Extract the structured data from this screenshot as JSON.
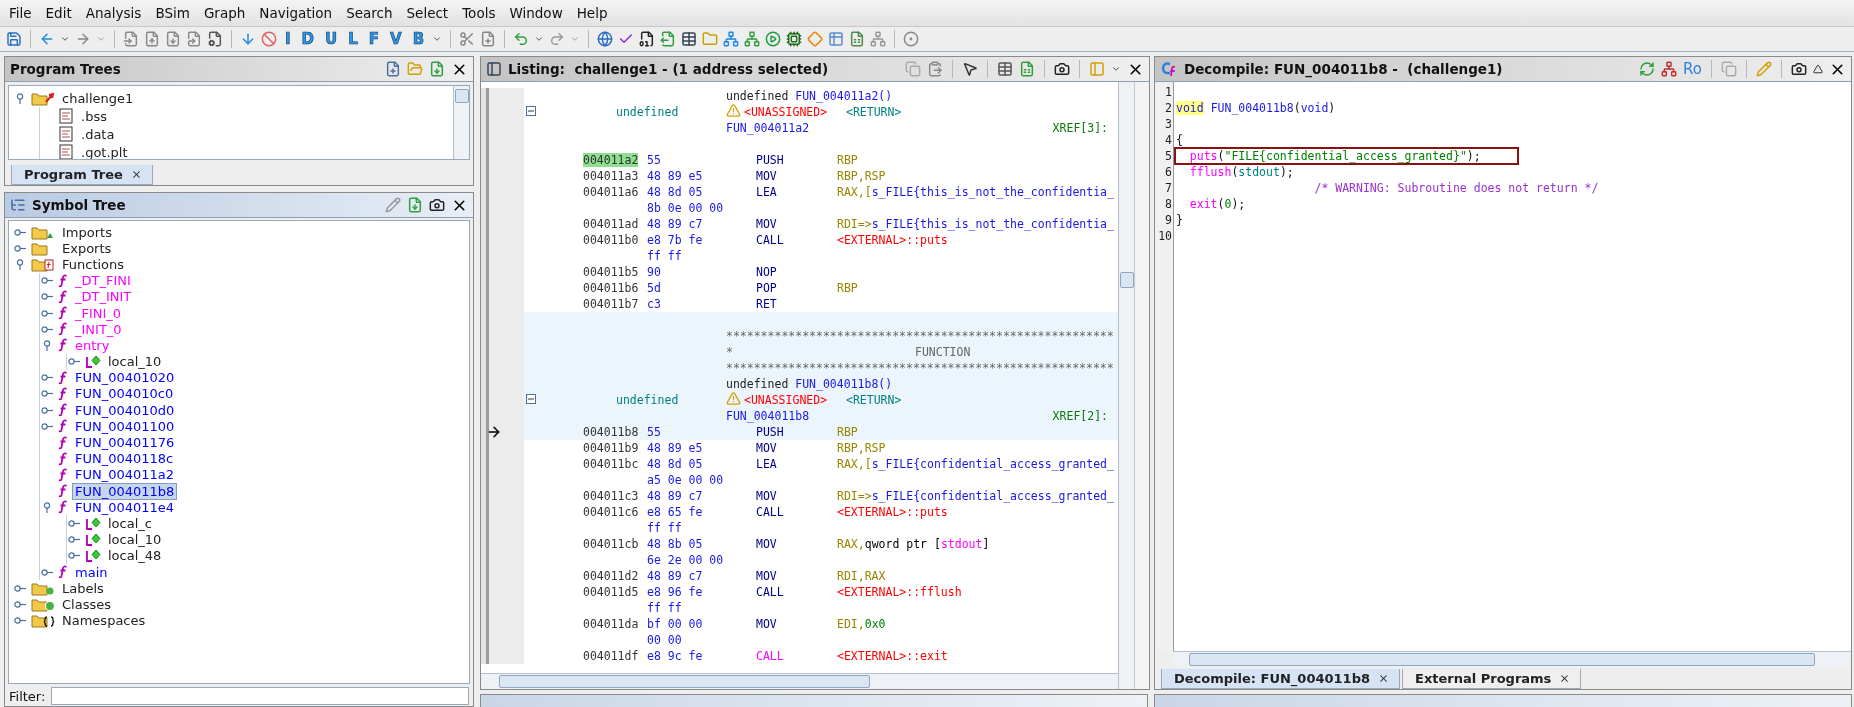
{
  "menu": [
    "File",
    "Edit",
    "Analysis",
    "BSim",
    "Graph",
    "Navigation",
    "Search",
    "Select",
    "Tools",
    "Window",
    "Help"
  ],
  "toolbar": {
    "letter_buttons": [
      "I",
      "D",
      "U",
      "L",
      "F",
      "V",
      "B"
    ]
  },
  "program_trees": {
    "title": "Program Trees",
    "tree": [
      {
        "label": "challenge1",
        "kind": "program",
        "expanded": true,
        "selected": false,
        "children": [
          {
            "label": ".bss",
            "kind": "fragment",
            "selected": false
          },
          {
            "label": ".data",
            "kind": "fragment",
            "selected": false
          },
          {
            "label": ".got.plt",
            "kind": "fragment",
            "selected": false
          }
        ]
      }
    ],
    "tabs": [
      {
        "label": "Program Tree",
        "selected": true
      }
    ]
  },
  "symbol_tree": {
    "title": "Symbol Tree",
    "tree": [
      {
        "label": "Imports",
        "kind": "imports",
        "expanded": false,
        "selected": false
      },
      {
        "label": "Exports",
        "kind": "folder",
        "expanded": false,
        "selected": false
      },
      {
        "label": "Functions",
        "kind": "functions",
        "expanded": true,
        "selected": false,
        "children": [
          {
            "label": "_DT_FINI",
            "kind": "function",
            "expanded": false,
            "selected": false,
            "color": "#ff00ff"
          },
          {
            "label": "_DT_INIT",
            "kind": "function",
            "expanded": false,
            "selected": false,
            "color": "#ff00ff"
          },
          {
            "label": "_FINI_0",
            "kind": "function",
            "expanded": false,
            "selected": false,
            "color": "#ff00ff"
          },
          {
            "label": "_INIT_0",
            "kind": "function",
            "expanded": false,
            "selected": false,
            "color": "#ff00ff"
          },
          {
            "label": "entry",
            "kind": "function",
            "expanded": true,
            "selected": false,
            "color": "#ff00ff",
            "children": [
              {
                "label": "local_10",
                "kind": "local",
                "expanded": false,
                "selected": false
              }
            ]
          },
          {
            "label": "FUN_00401020",
            "kind": "function",
            "expanded": false,
            "selected": false,
            "color": "#0000ff"
          },
          {
            "label": "FUN_004010c0",
            "kind": "function",
            "expanded": false,
            "selected": false,
            "color": "#0000ff"
          },
          {
            "label": "FUN_004010d0",
            "kind": "function",
            "expanded": false,
            "selected": false,
            "color": "#0000ff"
          },
          {
            "label": "FUN_00401100",
            "kind": "function",
            "expanded": false,
            "selected": false,
            "color": "#0000ff"
          },
          {
            "label": "FUN_00401176",
            "kind": "function",
            "selected": false,
            "color": "#0000ff"
          },
          {
            "label": "FUN_0040118c",
            "kind": "function",
            "selected": false,
            "color": "#0000ff"
          },
          {
            "label": "FUN_004011a2",
            "kind": "function",
            "selected": false,
            "color": "#0000ff"
          },
          {
            "label": "FUN_004011b8",
            "kind": "function",
            "selected": true,
            "color": "#0000ff"
          },
          {
            "label": "FUN_004011e4",
            "kind": "function",
            "expanded": true,
            "selected": false,
            "color": "#0000ff",
            "children": [
              {
                "label": "local_c",
                "kind": "local",
                "expanded": false,
                "selected": false
              },
              {
                "label": "local_10",
                "kind": "local",
                "expanded": false,
                "selected": false
              },
              {
                "label": "local_48",
                "kind": "local",
                "expanded": false,
                "selected": false
              }
            ]
          },
          {
            "label": "main",
            "kind": "function",
            "expanded": false,
            "selected": false,
            "color": "#0000ff"
          }
        ]
      },
      {
        "label": "Labels",
        "kind": "labels",
        "expanded": false,
        "selected": false
      },
      {
        "label": "Classes",
        "kind": "classes",
        "expanded": false,
        "selected": false
      },
      {
        "label": "Namespaces",
        "kind": "namespaces",
        "expanded": false,
        "selected": false
      }
    ],
    "filter": {
      "label": "Filter:"
    }
  },
  "listing": {
    "title": "Listing:  challenge1 - (1 address selected)",
    "blocks": [
      {
        "shaded": false,
        "rows": [
          {
            "kind": "signature",
            "type": "undefined",
            "name": "FUN_004011a2()"
          },
          {
            "kind": "return",
            "type": "undefined",
            "storage": "<UNASSIGNED>",
            "location": "<RETURN>",
            "expanded": true
          },
          {
            "kind": "label",
            "name": "FUN_004011a2",
            "xref": "XREF[3]:"
          },
          {
            "kind": "blank"
          },
          {
            "kind": "instr",
            "addr": "004011a2",
            "bytes": "55",
            "mnemonic": "PUSH",
            "operands": [
              {
                "t": "RBP",
                "kind": "reg"
              }
            ],
            "selected": true,
            "noreturn": false,
            "current": false
          },
          {
            "kind": "instr",
            "addr": "004011a3",
            "bytes": "48 89 e5",
            "mnemonic": "MOV",
            "operands": [
              {
                "t": "RBP,RSP",
                "kind": "reg"
              }
            ],
            "selected": false,
            "noreturn": false,
            "current": false
          },
          {
            "kind": "instr",
            "addr": "004011a6",
            "bytes": "48 8d 05",
            "mnemonic": "LEA",
            "operands": [
              {
                "t": "RAX,[",
                "kind": "reg"
              },
              {
                "t": "s_FILE{this_is_not_the_confidentia_",
                "kind": "str"
              }
            ],
            "selected": false,
            "noreturn": false,
            "current": false
          },
          {
            "kind": "bytes",
            "bytes": "8b 0e 00 00"
          },
          {
            "kind": "instr",
            "addr": "004011ad",
            "bytes": "48 89 c7",
            "mnemonic": "MOV",
            "operands": [
              {
                "t": "RDI=>",
                "kind": "reg"
              },
              {
                "t": "s_FILE{this_is_not_the_confidentia_",
                "kind": "str"
              }
            ],
            "selected": false,
            "noreturn": false,
            "current": false
          },
          {
            "kind": "instr",
            "addr": "004011b0",
            "bytes": "e8 7b fe",
            "mnemonic": "CALL",
            "operands": [
              {
                "t": "<EXTERNAL>::puts",
                "kind": "ext"
              }
            ],
            "selected": false,
            "noreturn": false,
            "current": false
          },
          {
            "kind": "bytes",
            "bytes": "ff ff"
          },
          {
            "kind": "instr",
            "addr": "004011b5",
            "bytes": "90",
            "mnemonic": "NOP",
            "selected": false,
            "noreturn": false,
            "current": false
          },
          {
            "kind": "instr",
            "addr": "004011b6",
            "bytes": "5d",
            "mnemonic": "POP",
            "operands": [
              {
                "t": "RBP",
                "kind": "reg"
              }
            ],
            "selected": false,
            "noreturn": false,
            "current": false
          },
          {
            "kind": "instr",
            "addr": "004011b7",
            "bytes": "c3",
            "mnemonic": "RET",
            "selected": false,
            "noreturn": false,
            "current": false
          }
        ]
      },
      {
        "shaded": true,
        "rows": [
          {
            "kind": "blank"
          },
          {
            "kind": "stars",
            "text": "********************************************************"
          },
          {
            "kind": "banner",
            "left": "*",
            "center": "FUNCTION"
          },
          {
            "kind": "stars",
            "text": "********************************************************"
          },
          {
            "kind": "signature",
            "type": "undefined",
            "name": "FUN_004011b8()"
          },
          {
            "kind": "return",
            "type": "undefined",
            "storage": "<UNASSIGNED>",
            "location": "<RETURN>",
            "expanded": true
          },
          {
            "kind": "label",
            "name": "FUN_004011b8",
            "xref": "XREF[2]:"
          },
          {
            "kind": "instr",
            "addr": "004011b8",
            "bytes": "55",
            "mnemonic": "PUSH",
            "operands": [
              {
                "t": "RBP",
                "kind": "reg"
              }
            ],
            "selected": false,
            "noreturn": false,
            "current": true
          }
        ]
      },
      {
        "shaded": false,
        "rows": [
          {
            "kind": "instr",
            "addr": "004011b9",
            "bytes": "48 89 e5",
            "mnemonic": "MOV",
            "operands": [
              {
                "t": "RBP,RSP",
                "kind": "reg"
              }
            ],
            "selected": false,
            "noreturn": false,
            "current": false
          },
          {
            "kind": "instr",
            "addr": "004011bc",
            "bytes": "48 8d 05",
            "mnemonic": "LEA",
            "operands": [
              {
                "t": "RAX,[",
                "kind": "reg"
              },
              {
                "t": "s_FILE{confidential_access_granted_",
                "kind": "str"
              }
            ],
            "selected": false,
            "noreturn": false,
            "current": false
          },
          {
            "kind": "bytes",
            "bytes": "a5 0e 00 00"
          },
          {
            "kind": "instr",
            "addr": "004011c3",
            "bytes": "48 89 c7",
            "mnemonic": "MOV",
            "operands": [
              {
                "t": "RDI=>",
                "kind": "reg"
              },
              {
                "t": "s_FILE{confidential_access_granted_",
                "kind": "str"
              }
            ],
            "selected": false,
            "noreturn": false,
            "current": false
          },
          {
            "kind": "instr",
            "addr": "004011c6",
            "bytes": "e8 65 fe",
            "mnemonic": "CALL",
            "operands": [
              {
                "t": "<EXTERNAL>::puts",
                "kind": "ext"
              }
            ],
            "selected": false,
            "noreturn": false,
            "current": false
          },
          {
            "kind": "bytes",
            "bytes": "ff ff"
          },
          {
            "kind": "instr",
            "addr": "004011cb",
            "bytes": "48 8b 05",
            "mnemonic": "MOV",
            "operands": [
              {
                "t": "RAX,",
                "kind": "reg"
              },
              {
                "t": "qword ptr [",
                "kind": "plain"
              },
              {
                "t": "stdout",
                "kind": "sym"
              },
              {
                "t": "]",
                "kind": "plain"
              }
            ],
            "selected": false,
            "noreturn": false,
            "current": false
          },
          {
            "kind": "bytes",
            "bytes": "6e 2e 00 00"
          },
          {
            "kind": "instr",
            "addr": "004011d2",
            "bytes": "48 89 c7",
            "mnemonic": "MOV",
            "operands": [
              {
                "t": "RDI,RAX",
                "kind": "reg"
              }
            ],
            "selected": false,
            "noreturn": false,
            "current": false
          },
          {
            "kind": "instr",
            "addr": "004011d5",
            "bytes": "e8 96 fe",
            "mnemonic": "CALL",
            "operands": [
              {
                "t": "<EXTERNAL>::fflush",
                "kind": "ext"
              }
            ],
            "selected": false,
            "noreturn": false,
            "current": false
          },
          {
            "kind": "bytes",
            "bytes": "ff ff"
          },
          {
            "kind": "instr",
            "addr": "004011da",
            "bytes": "bf 00 00",
            "mnemonic": "MOV",
            "operands": [
              {
                "t": "EDI,",
                "kind": "reg"
              },
              {
                "t": "0x0",
                "kind": "num"
              }
            ],
            "selected": false,
            "noreturn": false,
            "current": false
          },
          {
            "kind": "bytes",
            "bytes": "00 00"
          },
          {
            "kind": "instr",
            "addr": "004011df",
            "bytes": "e8 9c fe",
            "mnemonic": "CALL",
            "operands": [
              {
                "t": "<EXTERNAL>::exit",
                "kind": "ext"
              }
            ],
            "selected": false,
            "noreturn": true,
            "current": false
          }
        ]
      }
    ]
  },
  "decompile": {
    "title": "Decompile: FUN_004011b8 -  (challenge1)",
    "ro_label": "Ro",
    "lines": [
      {
        "number": "1",
        "boxed": false
      },
      {
        "number": "2",
        "boxed": false,
        "tokens": [
          {
            "t": "void",
            "kind": "kw",
            "highlighted": true
          },
          {
            "t": " FUN_004011b8",
            "kind": "func",
            "highlighted": false
          },
          {
            "t": "(",
            "kind": "plain",
            "highlighted": false
          },
          {
            "t": "void",
            "kind": "kw",
            "highlighted": false
          },
          {
            "t": ")",
            "kind": "plain",
            "highlighted": false
          }
        ]
      },
      {
        "number": "3",
        "boxed": false
      },
      {
        "number": "4",
        "boxed": false,
        "tokens": [
          {
            "t": "{",
            "kind": "plain",
            "highlighted": false
          }
        ]
      },
      {
        "number": "5",
        "boxed": true,
        "tokens": [
          {
            "t": "  puts",
            "kind": "call",
            "highlighted": false
          },
          {
            "t": "(",
            "kind": "plain",
            "highlighted": false
          },
          {
            "t": "\"FILE{confidential_access_granted}\"",
            "kind": "str",
            "highlighted": false
          },
          {
            "t": ");",
            "kind": "plain",
            "highlighted": false
          }
        ]
      },
      {
        "number": "6",
        "boxed": false,
        "tokens": [
          {
            "t": "  fflush",
            "kind": "call",
            "highlighted": false
          },
          {
            "t": "(",
            "kind": "plain",
            "highlighted": false
          },
          {
            "t": "stdout",
            "kind": "var",
            "highlighted": false
          },
          {
            "t": ");",
            "kind": "plain",
            "highlighted": false
          }
        ]
      },
      {
        "number": "7",
        "boxed": false,
        "tokens": [
          {
            "t": "                    /* WARNING: Subroutine does not return */",
            "kind": "comment",
            "highlighted": false
          }
        ]
      },
      {
        "number": "8",
        "boxed": false,
        "tokens": [
          {
            "t": "  exit",
            "kind": "call",
            "highlighted": false
          },
          {
            "t": "(",
            "kind": "plain",
            "highlighted": false
          },
          {
            "t": "0",
            "kind": "num",
            "highlighted": false
          },
          {
            "t": ");",
            "kind": "plain",
            "highlighted": false
          }
        ]
      },
      {
        "number": "9",
        "boxed": false,
        "tokens": [
          {
            "t": "}",
            "kind": "plain",
            "highlighted": false
          }
        ]
      },
      {
        "number": "10",
        "boxed": false
      }
    ],
    "tabs": [
      {
        "label": "Decompile: FUN_004011b8",
        "selected": true
      },
      {
        "label": "External Programs",
        "selected": false
      }
    ]
  }
}
